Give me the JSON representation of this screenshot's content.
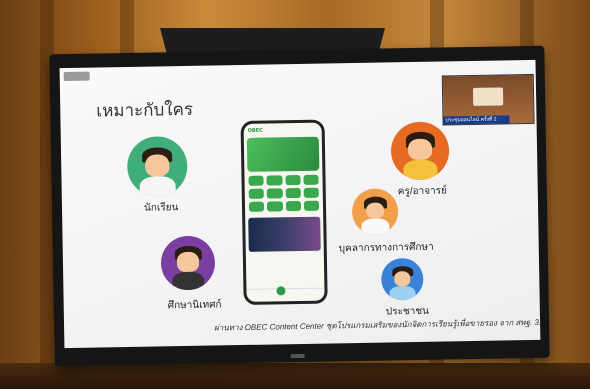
{
  "presentation": {
    "title": "เหมาะกับใคร",
    "footer": "ผ่านทาง OBEC Content Center ชุดโปรแกรมเสริมของนักจิตการเรียนรู้เพื่อขายรอง จาก สพฐ. 31",
    "inset_caption": "ประชุมออนไลน์ ครั้งที่ 2"
  },
  "audiences": [
    {
      "label": "นักเรียน",
      "color": "#3fae7a"
    },
    {
      "label": "ศึกษานิเทศก์",
      "color": "#7a3fa0"
    },
    {
      "label": "ครู/อาจารย์",
      "color": "#e66a22"
    },
    {
      "label": "บุคลากรทางการศึกษา",
      "color": "#f0a04b"
    },
    {
      "label": "ประชาชน",
      "color": "#3a82d6"
    }
  ],
  "phone_app": {
    "name": "OBEC"
  },
  "colors": {
    "app_green": "#2b9b48"
  }
}
